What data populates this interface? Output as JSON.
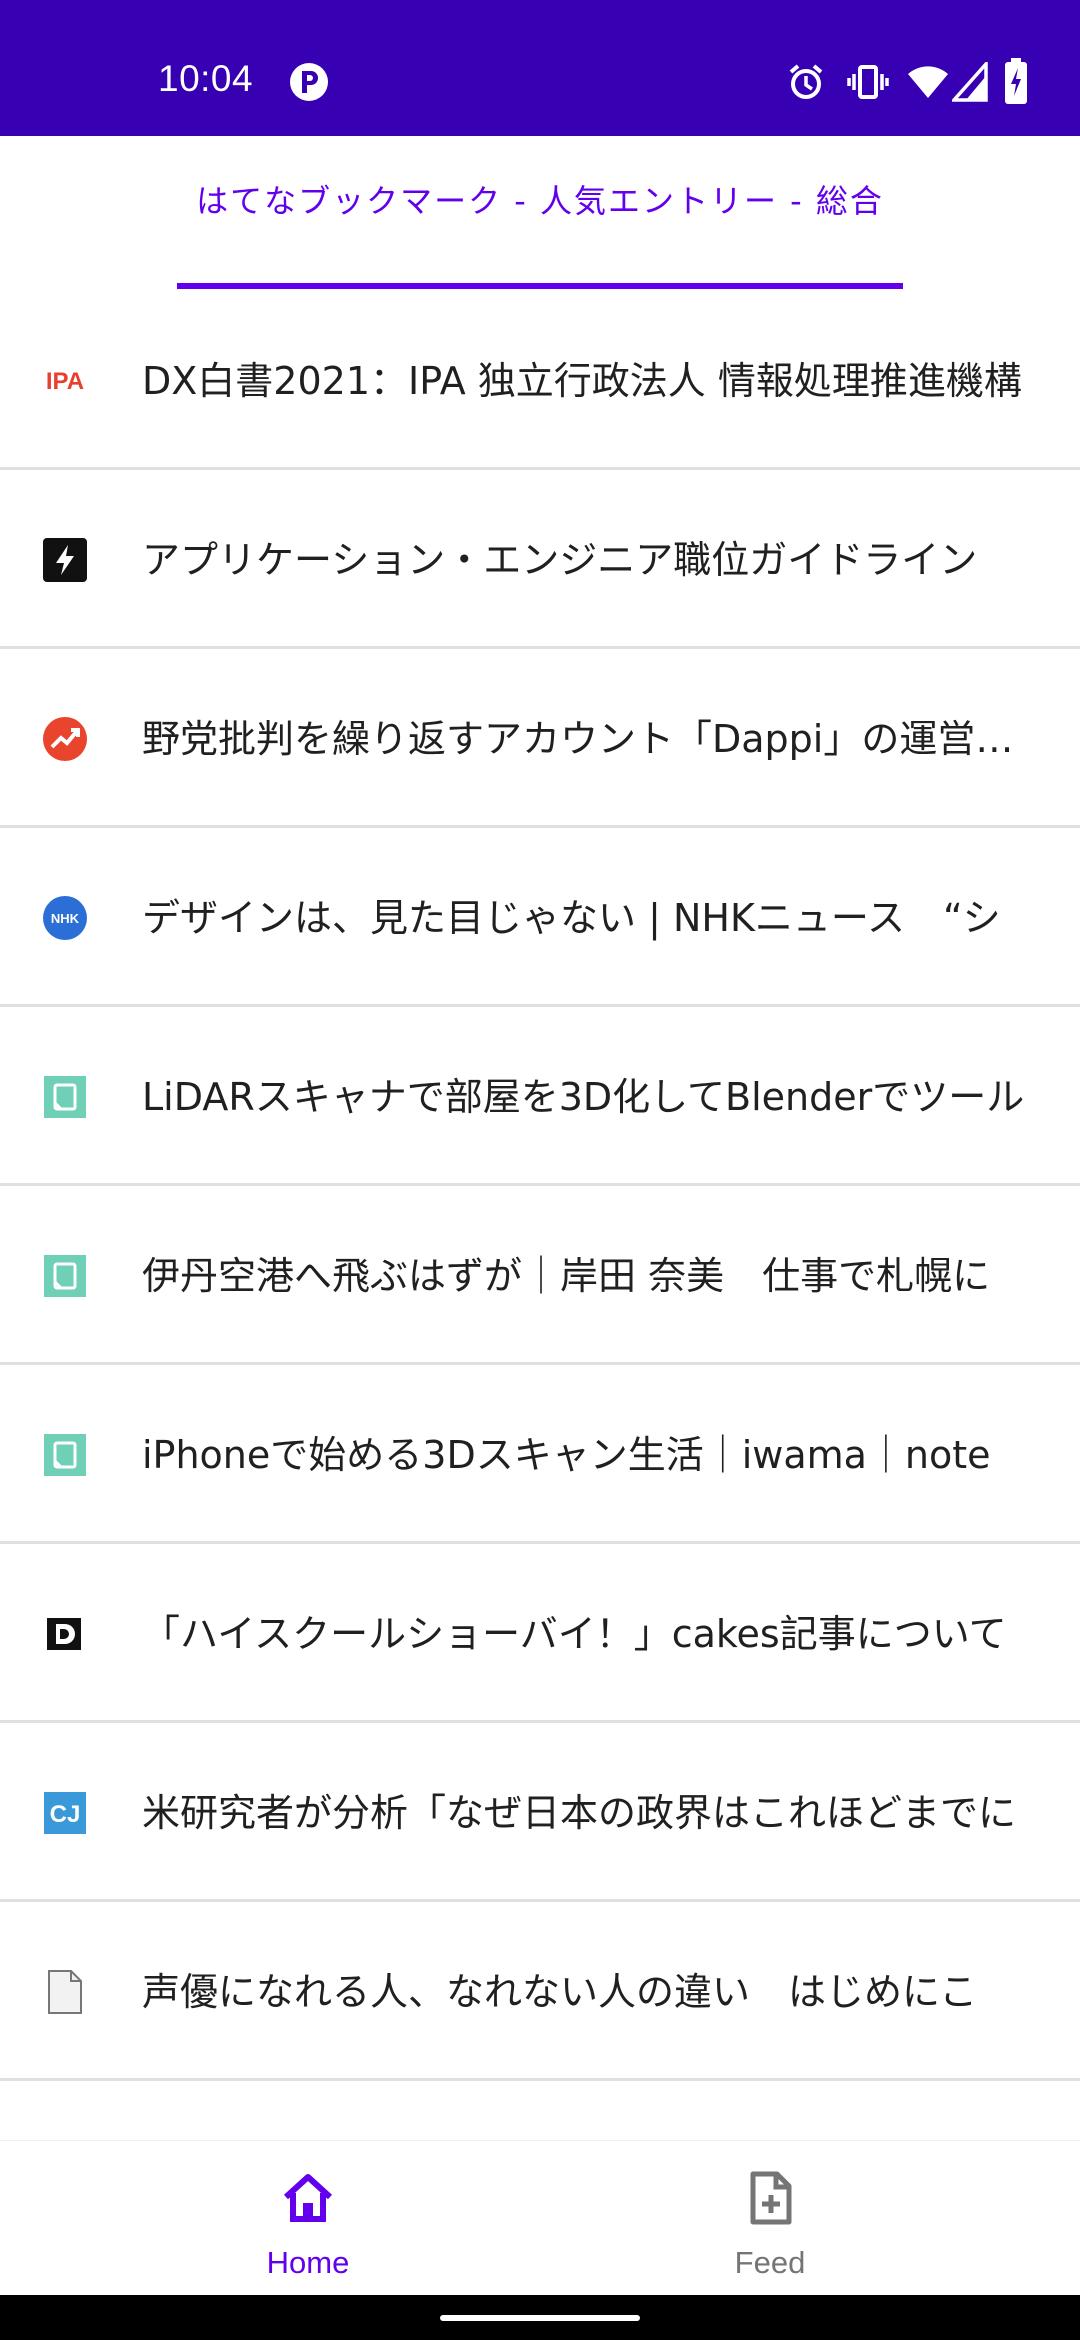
{
  "status_bar": {
    "time": "10:04",
    "icons": [
      "notification-p-icon",
      "alarm-icon",
      "vibrate-icon",
      "wifi-icon",
      "signal-icon",
      "battery-icon"
    ]
  },
  "header": {
    "tab_title": "はてなブックマーク - 人気エントリー - 総合"
  },
  "entries": [
    {
      "title": "DX白書2021：IPA 独立行政法人 情報処理推進機構",
      "icon": "ipa-favicon"
    },
    {
      "title": "アプリケーション・エンジニア職位ガイドライン",
      "icon": "lightning-favicon"
    },
    {
      "title": "野党批判を繰り返すアカウント「Dappi」の運営企業",
      "icon": "trend-favicon"
    },
    {
      "title": "デザインは、見た目じゃない | NHKニュース　“シ",
      "icon": "nhk-favicon"
    },
    {
      "title": "LiDARスキャナで部屋を3D化してBlenderでツール",
      "icon": "note-favicon"
    },
    {
      "title": "伊丹空港へ飛ぶはずが｜岸田 奈美　仕事で札幌に",
      "icon": "note-favicon"
    },
    {
      "title": "iPhoneで始める3Dスキャン生活｜iwama｜note",
      "icon": "note-favicon"
    },
    {
      "title": "「ハイスクールショーバイ！」cakes記事について",
      "icon": "d-favicon"
    },
    {
      "title": "米研究者が分析「なぜ日本の政界はこれほどまでに",
      "icon": "cj-favicon"
    },
    {
      "title": "声優になれる人、なれない人の違い　はじめにこ",
      "icon": "document-favicon"
    }
  ],
  "bottom_nav": {
    "home_label": "Home",
    "feed_label": "Feed"
  },
  "colors": {
    "status_bar": "#3700b3",
    "accent": "#6200ee",
    "inactive": "#757575"
  }
}
